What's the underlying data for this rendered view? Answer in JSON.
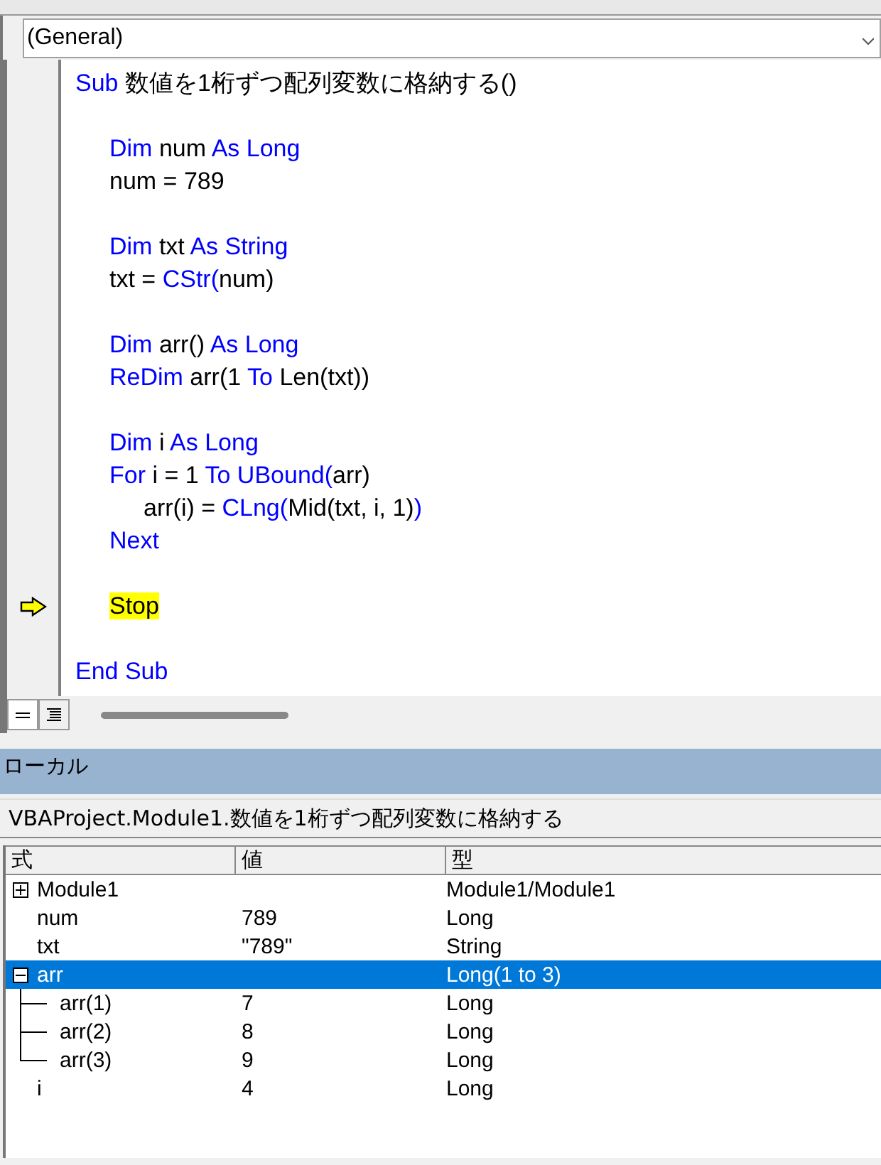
{
  "object_box": {
    "value": "(General)"
  },
  "code": {
    "lines": [
      {
        "kind": "code",
        "current": false,
        "segments": [
          {
            "kind": "keyword",
            "text": "Sub"
          },
          {
            "kind": "plain",
            "text": " 数値を1桁ずつ配列変数に格納する()"
          }
        ],
        "children": [
          {
            "kind": "blank",
            "current": false
          },
          {
            "kind": "code",
            "current": false,
            "segments": [
              {
                "kind": "keyword",
                "text": "Dim"
              },
              {
                "kind": "plain",
                "text": " num "
              },
              {
                "kind": "keyword",
                "text": "As Long"
              }
            ]
          },
          {
            "kind": "code",
            "current": false,
            "segments": [
              {
                "kind": "plain",
                "text": "num = 789"
              }
            ]
          },
          {
            "kind": "blank",
            "current": false
          },
          {
            "kind": "code",
            "current": false,
            "segments": [
              {
                "kind": "keyword",
                "text": "Dim"
              },
              {
                "kind": "plain",
                "text": " txt "
              },
              {
                "kind": "keyword",
                "text": "As String"
              }
            ]
          },
          {
            "kind": "code",
            "current": false,
            "segments": [
              {
                "kind": "plain",
                "text": "txt = "
              },
              {
                "kind": "keyword",
                "text": "CStr("
              },
              {
                "kind": "plain",
                "text": "num)"
              }
            ]
          },
          {
            "kind": "blank",
            "current": false
          },
          {
            "kind": "code",
            "current": false,
            "segments": [
              {
                "kind": "keyword",
                "text": "Dim"
              },
              {
                "kind": "plain",
                "text": " arr() "
              },
              {
                "kind": "keyword",
                "text": "As Long"
              }
            ]
          },
          {
            "kind": "code",
            "current": false,
            "segments": [
              {
                "kind": "keyword",
                "text": "ReDim"
              },
              {
                "kind": "plain",
                "text": " arr(1 "
              },
              {
                "kind": "keyword",
                "text": "To"
              },
              {
                "kind": "plain",
                "text": " Len(txt))"
              }
            ]
          },
          {
            "kind": "blank",
            "current": false
          },
          {
            "kind": "code",
            "current": false,
            "segments": [
              {
                "kind": "keyword",
                "text": "Dim"
              },
              {
                "kind": "plain",
                "text": " i "
              },
              {
                "kind": "keyword",
                "text": "As Long"
              }
            ]
          },
          {
            "kind": "code",
            "current": false,
            "segments": [
              {
                "kind": "keyword",
                "text": "For"
              },
              {
                "kind": "plain",
                "text": " i = 1 "
              },
              {
                "kind": "keyword",
                "text": "To UBound("
              },
              {
                "kind": "plain",
                "text": "arr)"
              }
            ],
            "children": [
              {
                "kind": "code",
                "current": false,
                "segments": [
                  {
                    "kind": "plain",
                    "text": "arr(i) = "
                  },
                  {
                    "kind": "keyword",
                    "text": "CLng("
                  },
                  {
                    "kind": "plain",
                    "text": "Mid(txt, i, 1)"
                  },
                  {
                    "kind": "keyword",
                    "text": ")"
                  }
                ]
              }
            ]
          },
          {
            "kind": "code",
            "current": false,
            "segments": [
              {
                "kind": "keyword",
                "text": "Next"
              }
            ]
          },
          {
            "kind": "blank",
            "current": false
          },
          {
            "kind": "code",
            "current": true,
            "segments": [
              {
                "kind": "plain",
                "text": "Stop"
              }
            ]
          },
          {
            "kind": "blank",
            "current": false
          }
        ]
      },
      {
        "kind": "code",
        "current": false,
        "segments": [
          {
            "kind": "keyword",
            "text": "End Sub"
          }
        ]
      }
    ]
  },
  "locals": {
    "title": "ローカル",
    "context": "VBAProject.Module1.数値を1桁ずつ配列変数に格納する",
    "columns": [
      "式",
      "値",
      "型"
    ],
    "rows": [
      {
        "expression": "Module1",
        "type": "Module1/Module1",
        "expanded": false,
        "selected": false
      },
      {
        "expression": "num",
        "value": "789",
        "type": "Long",
        "selected": false
      },
      {
        "expression": "txt",
        "value": "\"789\"",
        "type": "String",
        "selected": false
      },
      {
        "expression": "arr",
        "type": "Long(1 to 3)",
        "expanded": true,
        "selected": true,
        "children": [
          {
            "expression": "arr(1)",
            "value": "7",
            "type": "Long",
            "selected": false
          },
          {
            "expression": "arr(2)",
            "value": "8",
            "type": "Long",
            "selected": false
          },
          {
            "expression": "arr(3)",
            "value": "9",
            "type": "Long",
            "selected": false
          }
        ]
      },
      {
        "expression": "i",
        "value": "4",
        "type": "Long",
        "selected": false
      }
    ]
  }
}
